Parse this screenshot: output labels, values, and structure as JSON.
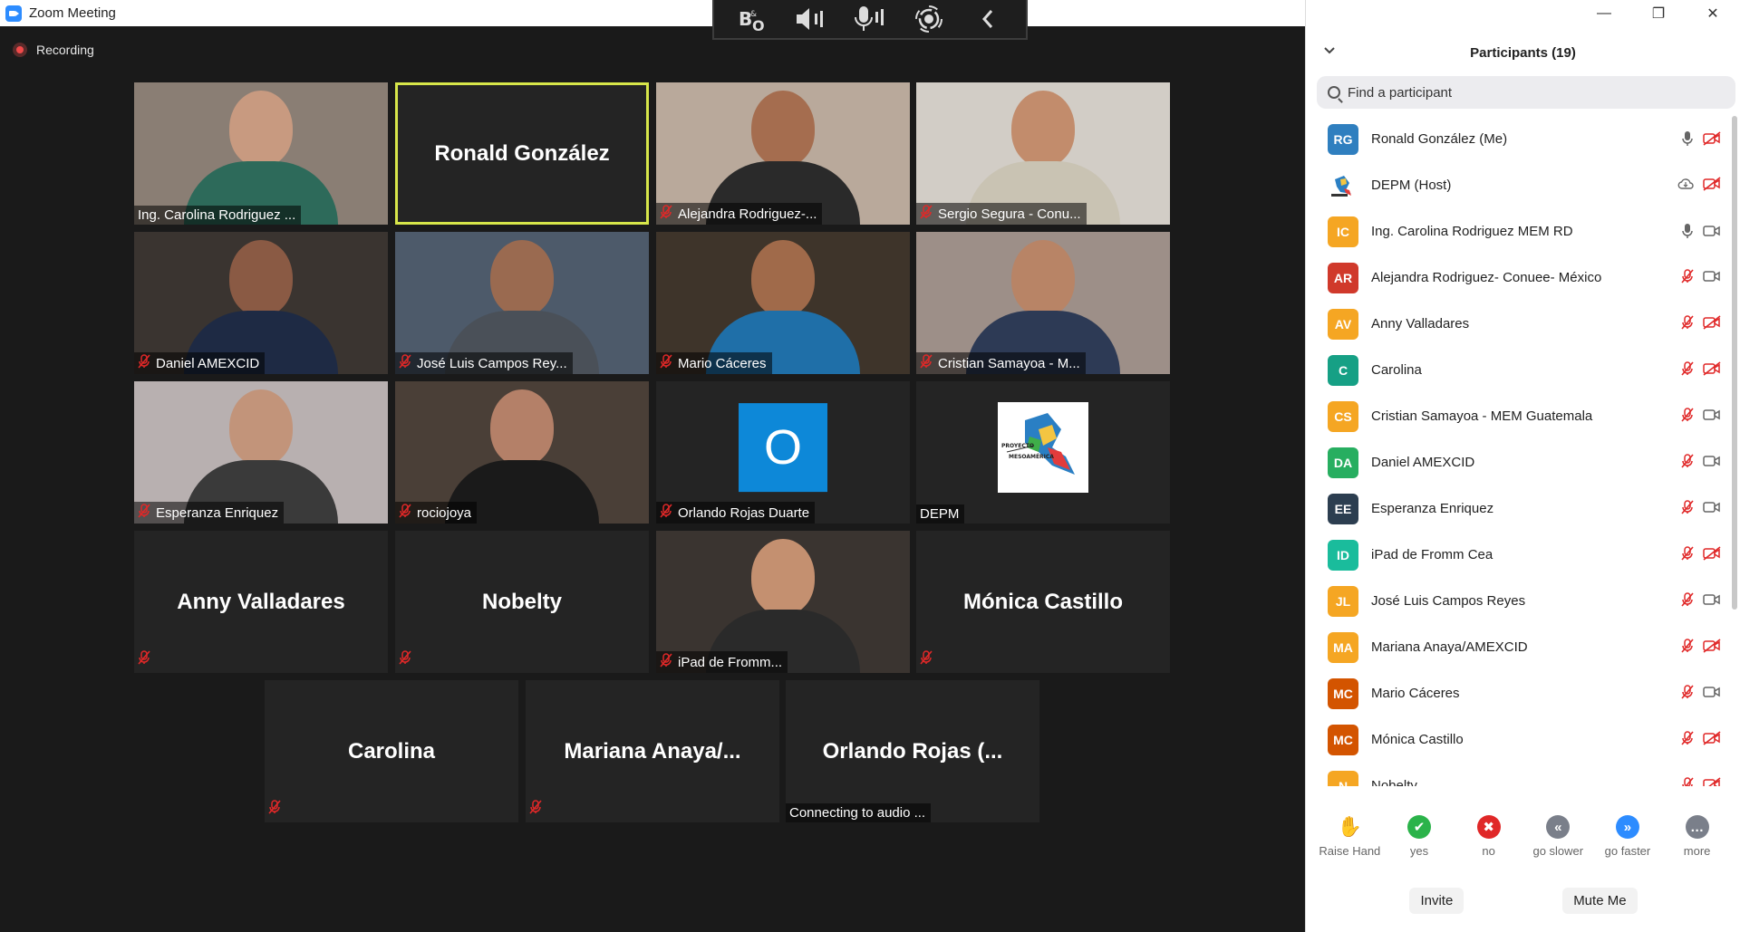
{
  "window": {
    "title": "Zoom Meeting"
  },
  "recording": {
    "label": "Recording"
  },
  "gallery": {
    "tiles": [
      {
        "label": "Ing. Carolina Rodriguez ...",
        "muted": false,
        "video": true
      },
      {
        "name": "Ronald González",
        "active": true,
        "video": false
      },
      {
        "label": "Alejandra Rodriguez-...",
        "muted": true,
        "video": true
      },
      {
        "label": "Sergio Segura - Conu...",
        "muted": true,
        "video": true
      },
      {
        "label": "Daniel AMEXCID",
        "muted": true,
        "video": true
      },
      {
        "label": "José Luis Campos Rey...",
        "muted": true,
        "video": true
      },
      {
        "label": "Mario Cáceres",
        "muted": true,
        "video": true
      },
      {
        "label": "Cristian Samayoa - M...",
        "muted": true,
        "video": true
      },
      {
        "label": "Esperanza Enriquez",
        "muted": true,
        "video": true
      },
      {
        "label": "rociojoya",
        "muted": true,
        "video": true
      },
      {
        "label": "Orlando Rojas Duarte",
        "muted": true,
        "avatar_letter": "O"
      },
      {
        "label": "DEPM",
        "muted": false,
        "logo": true
      },
      {
        "name": "Anny Valladares",
        "muted": true
      },
      {
        "name": "Nobelty",
        "muted": true
      },
      {
        "label": "iPad de Fromm...",
        "muted": true,
        "video": true
      },
      {
        "name": "Mónica Castillo",
        "muted": true
      },
      {
        "name": "Carolina",
        "muted": true
      },
      {
        "name": "Mariana  Anaya/...",
        "muted": true
      },
      {
        "name": "Orlando  Rojas  (...",
        "status": "Connecting to audio ..."
      }
    ]
  },
  "panel": {
    "title": "Participants (19)",
    "search_placeholder": "Find a participant",
    "participants": [
      {
        "initials": "RG",
        "name": "Ronald González (Me)",
        "color": "#2f7fbf",
        "mic": "on",
        "video": "off"
      },
      {
        "initials": "",
        "name": "DEPM (Host)",
        "color": "#ffffff",
        "mic": "cloud",
        "video": "off"
      },
      {
        "initials": "IC",
        "name": "Ing. Carolina Rodriguez MEM RD",
        "color": "#f5a623",
        "mic": "on",
        "video": "on"
      },
      {
        "initials": "AR",
        "name": " Alejandra Rodriguez- Conuee- México",
        "color": "#d0392b",
        "mic": "off",
        "video": "on"
      },
      {
        "initials": "AV",
        "name": "Anny Valladares",
        "color": "#f5a623",
        "mic": "off",
        "video": "off"
      },
      {
        "initials": "C",
        "name": "Carolina",
        "color": "#16a085",
        "mic": "off",
        "video": "off"
      },
      {
        "initials": "CS",
        "name": "Cristian Samayoa - MEM Guatemala",
        "color": "#f5a623",
        "mic": "off",
        "video": "on"
      },
      {
        "initials": "DA",
        "name": "Daniel AMEXCID",
        "color": "#27ae60",
        "mic": "off",
        "video": "on"
      },
      {
        "initials": "EE",
        "name": "Esperanza Enriquez",
        "color": "#2c3e50",
        "mic": "off",
        "video": "on"
      },
      {
        "initials": "ID",
        "name": "iPad de Fromm Cea",
        "color": "#1abc9c",
        "mic": "off",
        "video": "off"
      },
      {
        "initials": "JL",
        "name": "José Luis Campos Reyes",
        "color": "#f5a623",
        "mic": "off",
        "video": "on"
      },
      {
        "initials": "MA",
        "name": "Mariana Anaya/AMEXCID",
        "color": "#f5a623",
        "mic": "off",
        "video": "off"
      },
      {
        "initials": "MC",
        "name": "Mario Cáceres",
        "color": "#d35400",
        "mic": "off",
        "video": "on"
      },
      {
        "initials": "MC",
        "name": "Mónica Castillo",
        "color": "#d35400",
        "mic": "off",
        "video": "off"
      },
      {
        "initials": "N",
        "name": "Nobelty",
        "color": "#f5a623",
        "mic": "off",
        "video": "off"
      }
    ],
    "reactions": [
      {
        "label": "Raise Hand",
        "icon": "raise-hand-icon",
        "color": "#2d8cff"
      },
      {
        "label": "yes",
        "icon": "check-icon",
        "color": "#2bb34a"
      },
      {
        "label": "no",
        "icon": "x-icon",
        "color": "#e02828"
      },
      {
        "label": "go slower",
        "icon": "rewind-icon",
        "color": "#7a7f8a"
      },
      {
        "label": "go faster",
        "icon": "fast-forward-icon",
        "color": "#2d8cff"
      },
      {
        "label": "more",
        "icon": "more-icon",
        "color": "#7a7f8a"
      }
    ],
    "invite_label": "Invite",
    "mute_me_label": "Mute Me"
  }
}
